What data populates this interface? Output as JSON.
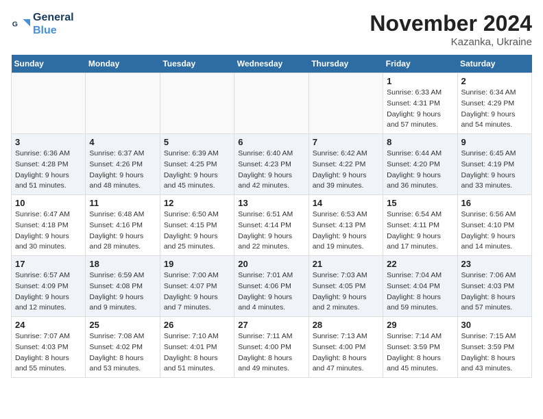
{
  "logo": {
    "line1": "General",
    "line2": "Blue"
  },
  "title": "November 2024",
  "location": "Kazanka, Ukraine",
  "days_header": [
    "Sunday",
    "Monday",
    "Tuesday",
    "Wednesday",
    "Thursday",
    "Friday",
    "Saturday"
  ],
  "weeks": [
    [
      {
        "day": "",
        "info": ""
      },
      {
        "day": "",
        "info": ""
      },
      {
        "day": "",
        "info": ""
      },
      {
        "day": "",
        "info": ""
      },
      {
        "day": "",
        "info": ""
      },
      {
        "day": "1",
        "info": "Sunrise: 6:33 AM\nSunset: 4:31 PM\nDaylight: 9 hours\nand 57 minutes."
      },
      {
        "day": "2",
        "info": "Sunrise: 6:34 AM\nSunset: 4:29 PM\nDaylight: 9 hours\nand 54 minutes."
      }
    ],
    [
      {
        "day": "3",
        "info": "Sunrise: 6:36 AM\nSunset: 4:28 PM\nDaylight: 9 hours\nand 51 minutes."
      },
      {
        "day": "4",
        "info": "Sunrise: 6:37 AM\nSunset: 4:26 PM\nDaylight: 9 hours\nand 48 minutes."
      },
      {
        "day": "5",
        "info": "Sunrise: 6:39 AM\nSunset: 4:25 PM\nDaylight: 9 hours\nand 45 minutes."
      },
      {
        "day": "6",
        "info": "Sunrise: 6:40 AM\nSunset: 4:23 PM\nDaylight: 9 hours\nand 42 minutes."
      },
      {
        "day": "7",
        "info": "Sunrise: 6:42 AM\nSunset: 4:22 PM\nDaylight: 9 hours\nand 39 minutes."
      },
      {
        "day": "8",
        "info": "Sunrise: 6:44 AM\nSunset: 4:20 PM\nDaylight: 9 hours\nand 36 minutes."
      },
      {
        "day": "9",
        "info": "Sunrise: 6:45 AM\nSunset: 4:19 PM\nDaylight: 9 hours\nand 33 minutes."
      }
    ],
    [
      {
        "day": "10",
        "info": "Sunrise: 6:47 AM\nSunset: 4:18 PM\nDaylight: 9 hours\nand 30 minutes."
      },
      {
        "day": "11",
        "info": "Sunrise: 6:48 AM\nSunset: 4:16 PM\nDaylight: 9 hours\nand 28 minutes."
      },
      {
        "day": "12",
        "info": "Sunrise: 6:50 AM\nSunset: 4:15 PM\nDaylight: 9 hours\nand 25 minutes."
      },
      {
        "day": "13",
        "info": "Sunrise: 6:51 AM\nSunset: 4:14 PM\nDaylight: 9 hours\nand 22 minutes."
      },
      {
        "day": "14",
        "info": "Sunrise: 6:53 AM\nSunset: 4:13 PM\nDaylight: 9 hours\nand 19 minutes."
      },
      {
        "day": "15",
        "info": "Sunrise: 6:54 AM\nSunset: 4:11 PM\nDaylight: 9 hours\nand 17 minutes."
      },
      {
        "day": "16",
        "info": "Sunrise: 6:56 AM\nSunset: 4:10 PM\nDaylight: 9 hours\nand 14 minutes."
      }
    ],
    [
      {
        "day": "17",
        "info": "Sunrise: 6:57 AM\nSunset: 4:09 PM\nDaylight: 9 hours\nand 12 minutes."
      },
      {
        "day": "18",
        "info": "Sunrise: 6:59 AM\nSunset: 4:08 PM\nDaylight: 9 hours\nand 9 minutes."
      },
      {
        "day": "19",
        "info": "Sunrise: 7:00 AM\nSunset: 4:07 PM\nDaylight: 9 hours\nand 7 minutes."
      },
      {
        "day": "20",
        "info": "Sunrise: 7:01 AM\nSunset: 4:06 PM\nDaylight: 9 hours\nand 4 minutes."
      },
      {
        "day": "21",
        "info": "Sunrise: 7:03 AM\nSunset: 4:05 PM\nDaylight: 9 hours\nand 2 minutes."
      },
      {
        "day": "22",
        "info": "Sunrise: 7:04 AM\nSunset: 4:04 PM\nDaylight: 8 hours\nand 59 minutes."
      },
      {
        "day": "23",
        "info": "Sunrise: 7:06 AM\nSunset: 4:03 PM\nDaylight: 8 hours\nand 57 minutes."
      }
    ],
    [
      {
        "day": "24",
        "info": "Sunrise: 7:07 AM\nSunset: 4:03 PM\nDaylight: 8 hours\nand 55 minutes."
      },
      {
        "day": "25",
        "info": "Sunrise: 7:08 AM\nSunset: 4:02 PM\nDaylight: 8 hours\nand 53 minutes."
      },
      {
        "day": "26",
        "info": "Sunrise: 7:10 AM\nSunset: 4:01 PM\nDaylight: 8 hours\nand 51 minutes."
      },
      {
        "day": "27",
        "info": "Sunrise: 7:11 AM\nSunset: 4:00 PM\nDaylight: 8 hours\nand 49 minutes."
      },
      {
        "day": "28",
        "info": "Sunrise: 7:13 AM\nSunset: 4:00 PM\nDaylight: 8 hours\nand 47 minutes."
      },
      {
        "day": "29",
        "info": "Sunrise: 7:14 AM\nSunset: 3:59 PM\nDaylight: 8 hours\nand 45 minutes."
      },
      {
        "day": "30",
        "info": "Sunrise: 7:15 AM\nSunset: 3:59 PM\nDaylight: 8 hours\nand 43 minutes."
      }
    ]
  ]
}
